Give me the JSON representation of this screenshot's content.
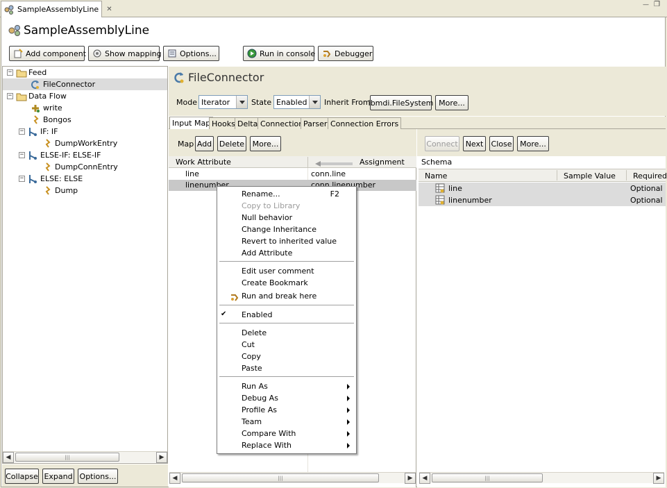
{
  "editor_tab": {
    "label": "SampleAssemblyLine",
    "close_glyph": "✕"
  },
  "window_controls": {
    "minimize": "—",
    "restore": "❐"
  },
  "page_title": "SampleAssemblyLine",
  "toolbar": {
    "add_component": "Add component",
    "show_mapping": "Show mapping",
    "options": "Options...",
    "run_in_console": "Run in console",
    "debugger": "Debugger"
  },
  "tree": {
    "feed": "Feed",
    "file_connector": "FileConnector",
    "data_flow": "Data Flow",
    "write": "write",
    "bongos": "Bongos",
    "if": "IF: IF",
    "dump_work_entry": "DumpWorkEntry",
    "else_if": "ELSE-IF: ELSE-IF",
    "dump_conn_entry": "DumpConnEntry",
    "else": "ELSE: ELSE",
    "dump": "Dump",
    "expander_collapsed": "−"
  },
  "left_bottom": {
    "collapse": "Collapse",
    "expand": "Expand",
    "options": "Options..."
  },
  "connector": {
    "title": "FileConnector",
    "mode_label": "Mode",
    "mode_value": "Iterator",
    "state_label": "State",
    "state_value": "Enabled",
    "inherit_label": "Inherit From",
    "inherit_value": "ibmdi.FileSystem",
    "more": "More..."
  },
  "tabs": [
    "Input Map",
    "Hooks",
    "Delta",
    "Connection",
    "Parser",
    "Connection Errors"
  ],
  "map_toolbar": {
    "label": "Map",
    "add": "Add",
    "delete": "Delete",
    "more": "More..."
  },
  "map_table": {
    "headers": {
      "work_attribute": "Work Attribute",
      "assignment": "Assignment"
    },
    "rows": [
      {
        "attr": "line",
        "assign": "conn.line"
      },
      {
        "attr": "linenumber",
        "assign": "conn.linenumber"
      }
    ]
  },
  "schema_toolbar": {
    "connect": "Connect",
    "next": "Next",
    "close": "Close",
    "more": "More..."
  },
  "schema": {
    "label": "Schema",
    "headers": {
      "name": "Name",
      "sample_value": "Sample Value",
      "required": "Required"
    },
    "rows": [
      {
        "name": "line",
        "required": "Optional"
      },
      {
        "name": "linenumber",
        "required": "Optional"
      }
    ]
  },
  "context_menu": {
    "rename": "Rename...",
    "rename_shortcut": "F2",
    "copy_to_library": "Copy to Library",
    "null_behavior": "Null behavior",
    "change_inheritance": "Change Inheritance",
    "revert": "Revert to inherited value",
    "add_attribute": "Add Attribute",
    "edit_comment": "Edit user comment",
    "create_bookmark": "Create Bookmark",
    "run_and_break": "Run and break here",
    "enabled": "Enabled",
    "enabled_check": "✔",
    "delete": "Delete",
    "cut": "Cut",
    "copy": "Copy",
    "paste": "Paste",
    "run_as": "Run As",
    "debug_as": "Debug As",
    "profile_as": "Profile As",
    "team": "Team",
    "compare_with": "Compare With",
    "replace_with": "Replace With"
  },
  "scroll": {
    "left": "◀",
    "right": "▶",
    "grip": "|||"
  },
  "colors": {
    "selection": "#c8c8c8",
    "panel": "#ece9d8",
    "border": "#a8a59a"
  }
}
